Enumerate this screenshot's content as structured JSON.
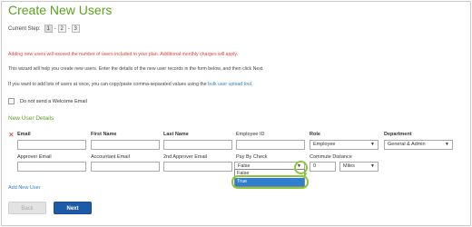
{
  "page": {
    "title": "Create New Users",
    "current_step_label": "Current Step:",
    "steps": [
      "1",
      "2",
      "3"
    ],
    "step_sep": "-",
    "warning": "Adding new users will exceed the number of users included in your plan. Additional monthly charges will apply.",
    "info1": "This wizard will help you create new users. Enter the details of the new user records in the form below, and then click Next.",
    "info2_prefix": "If you want to add lots of users at once, you can copy/paste comma-separated values using the ",
    "info2_link": "bulk user upload tool",
    "info2_suffix": "."
  },
  "welcome": {
    "label": "Do not send a Welcome Email"
  },
  "section": {
    "title": "New User Details"
  },
  "row1": {
    "email_label": "Email",
    "first_name_label": "First Name",
    "last_name_label": "Last Name",
    "employee_id_label": "Employee ID",
    "role_label": "Role",
    "role_value": "Employee",
    "department_label": "Department",
    "department_value": "General & Admin"
  },
  "row2": {
    "approver_email_label": "Approver Email",
    "accountant_email_label": "Accountant Email",
    "approver2_email_label": "2nd Approver Email",
    "pay_by_check_label": "Pay By Check",
    "pay_by_check_value": "False",
    "commute_label": "Commute Distance",
    "commute_value": "0",
    "commute_unit": "Miles"
  },
  "dropdown": {
    "options": [
      "False",
      "True"
    ],
    "highlighted": 1
  },
  "actions": {
    "add_new_user": "Add New User",
    "back": "Back",
    "next": "Next"
  },
  "icons": {
    "remove": "close-icon",
    "dropdown_arrow": "chevron-down-icon"
  },
  "colors": {
    "accent": "#5aa01f",
    "warning": "#e0403a",
    "link": "#2f7fc0",
    "primary": "#1f5aa6",
    "highlight": "#8cc63f"
  }
}
